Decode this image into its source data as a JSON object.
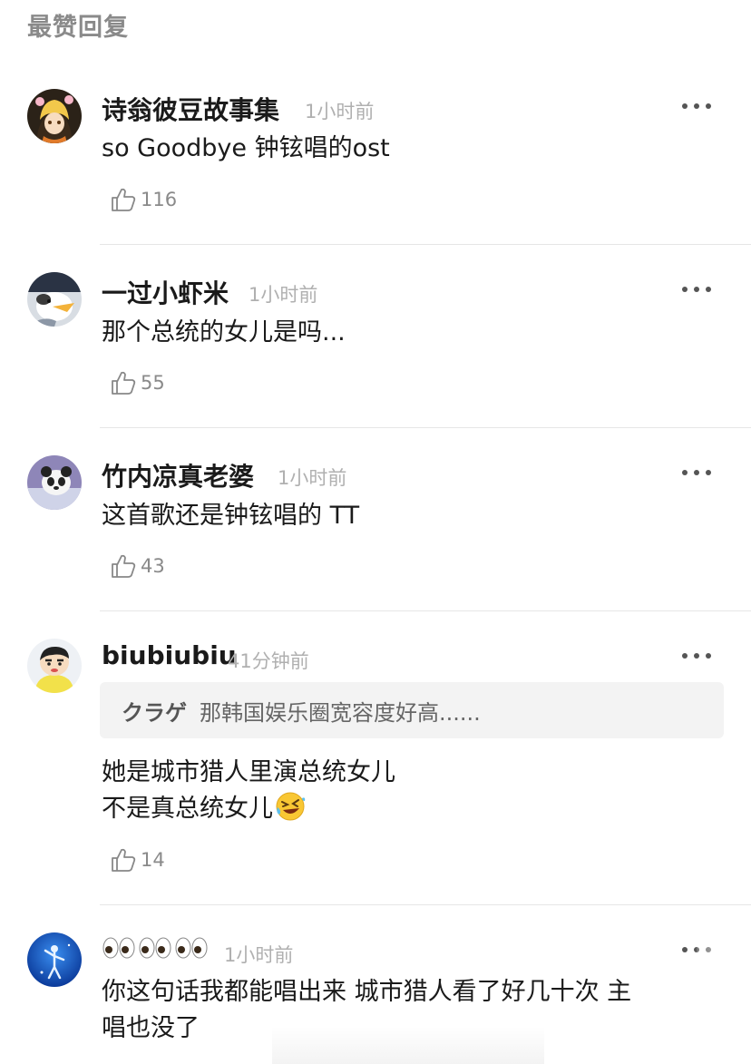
{
  "section_title": "最赞回复",
  "comments": [
    {
      "username": "诗翁彼豆故事集",
      "time": "1小时前",
      "text": "so Goodbye 钟铉唱的ost",
      "likes": "116",
      "avatar_icon": "anime-character-avatar-icon"
    },
    {
      "username": "一过小虾米",
      "time": "1小时前",
      "text": "那个总统的女儿是吗...",
      "likes": "55",
      "avatar_icon": "penguin-avatar-icon"
    },
    {
      "username": "竹内凉真老婆",
      "time": "1小时前",
      "text": "这首歌还是钟铉唱的 TT",
      "likes": "43",
      "avatar_icon": "panda-avatar-icon"
    },
    {
      "username": "biubiubiu",
      "time": "41分钟前",
      "quote_user": "クラゲ",
      "quote_text": "那韩国娱乐圈宽容度好高......",
      "text_line1": "她是城市猎人里演总统女儿",
      "text_line2": "不是真总统女儿",
      "likes": "14",
      "avatar_icon": "cartoon-boy-avatar-icon"
    },
    {
      "username": "",
      "time": "1小时前",
      "text_line1": "你这句话我都能唱出来 城市猎人看了好几十次 主",
      "text_line2": "唱也没了",
      "avatar_icon": "blue-figure-avatar-icon"
    }
  ],
  "colors": {
    "title_gray": "#8a8a8a",
    "time_gray": "#b0b0b0",
    "text": "#1a1a1a",
    "divider": "#e6e6e6",
    "quote_bg": "#f3f3f3"
  }
}
